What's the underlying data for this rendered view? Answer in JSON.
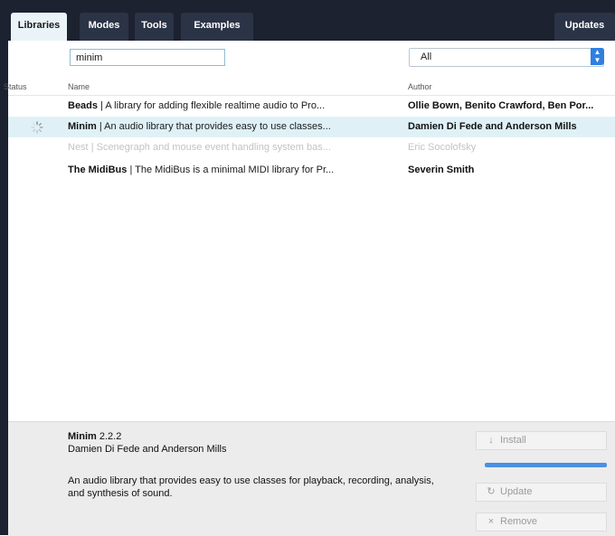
{
  "tabs": [
    {
      "label": "Libraries",
      "active": true
    },
    {
      "label": "Modes",
      "active": false
    },
    {
      "label": "Tools",
      "active": false
    },
    {
      "label": "Examples",
      "active": false
    }
  ],
  "updates_tab_label": "Updates",
  "search": {
    "value": "minim",
    "placeholder": ""
  },
  "filter": {
    "selected": "All"
  },
  "columns": {
    "status": "Status",
    "name": "Name",
    "author": "Author"
  },
  "libraries": [
    {
      "name": "Beads",
      "description": "| A library for adding flexible realtime audio to Pro...",
      "author": "Ollie Bown, Benito Crawford, Ben Por...",
      "status_icon": "none",
      "selected": false,
      "disabled": false
    },
    {
      "name": "Minim",
      "description": "| An audio library that provides easy to use classes...",
      "author": "Damien Di Fede and Anderson Mills",
      "status_icon": "spinner-icon",
      "selected": true,
      "disabled": false
    },
    {
      "name": "Nest",
      "description": "| Scenegraph and mouse event handling system bas...",
      "author": "Eric Socolofsky",
      "status_icon": "none",
      "selected": false,
      "disabled": true
    },
    {
      "name": "The MidiBus",
      "description": "| The MidiBus is a minimal MIDI library for Pr...",
      "author": "Severin Smith",
      "status_icon": "none",
      "selected": false,
      "disabled": false
    }
  ],
  "details": {
    "name": "Minim",
    "version": "2.2.2",
    "author": "Damien Di Fede and Anderson Mills",
    "description": "An audio library that provides easy to use classes for playback, recording, analysis, and synthesis of sound."
  },
  "buttons": {
    "install": {
      "label": "Install",
      "icon": "download-arrow-icon"
    },
    "update": {
      "label": "Update",
      "icon": "refresh-icon"
    },
    "remove": {
      "label": "Remove",
      "icon": "close-x-icon"
    }
  },
  "progress": {
    "fraction": 1.0
  },
  "colors": {
    "accent": "#2f7fe0",
    "selected_row": "#dff1f7",
    "tabbar": "#1d2230",
    "progress": "#4a90e2"
  }
}
